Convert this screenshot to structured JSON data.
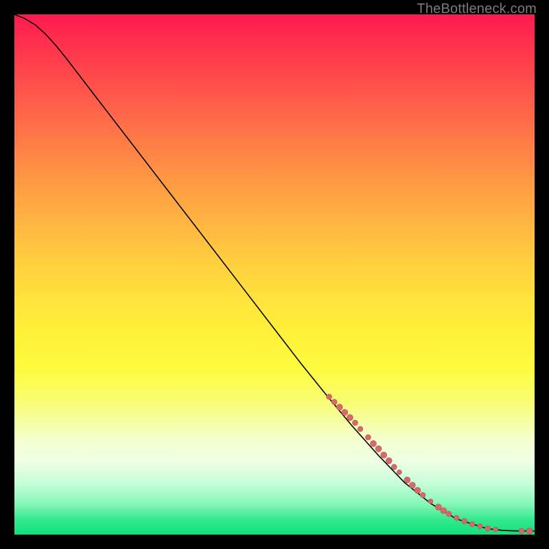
{
  "attribution": "TheBottleneck.com",
  "colors": {
    "line": "#000000",
    "marker_fill": "#d46a6a",
    "marker_stroke": "#b85454",
    "background_black": "#000000"
  },
  "chart_data": {
    "type": "line",
    "title": "",
    "xlabel": "",
    "ylabel": "",
    "xlim": [
      0,
      100
    ],
    "ylim": [
      0,
      100
    ],
    "series": [
      {
        "name": "curve",
        "x": [
          0,
          2,
          4,
          6,
          8,
          10,
          15,
          20,
          25,
          30,
          35,
          40,
          45,
          50,
          55,
          60,
          65,
          70,
          75,
          80,
          85,
          90,
          92,
          94,
          95,
          96,
          97,
          98,
          100
        ],
        "y": [
          100,
          99.2,
          98.0,
          96.2,
          94.0,
          91.5,
          85.0,
          78.5,
          72.0,
          65.5,
          59.0,
          52.5,
          46.0,
          39.5,
          33.0,
          26.8,
          20.8,
          15.2,
          10.0,
          6.0,
          3.0,
          1.4,
          1.0,
          0.8,
          0.75,
          0.72,
          0.7,
          0.7,
          0.7
        ]
      }
    ],
    "markers": {
      "name": "highlighted-points",
      "points": [
        {
          "x": 60.5,
          "y": 26.5,
          "r": 4.0
        },
        {
          "x": 61.5,
          "y": 25.5,
          "r": 4.0
        },
        {
          "x": 62.5,
          "y": 24.5,
          "r": 4.5
        },
        {
          "x": 63.5,
          "y": 23.5,
          "r": 4.5
        },
        {
          "x": 64.5,
          "y": 22.5,
          "r": 4.5
        },
        {
          "x": 65.5,
          "y": 21.5,
          "r": 4.0
        },
        {
          "x": 66.5,
          "y": 20.3,
          "r": 3.8
        },
        {
          "x": 68.0,
          "y": 18.7,
          "r": 4.0
        },
        {
          "x": 69.0,
          "y": 17.5,
          "r": 4.5
        },
        {
          "x": 70.0,
          "y": 16.5,
          "r": 4.5
        },
        {
          "x": 71.0,
          "y": 15.3,
          "r": 4.5
        },
        {
          "x": 72.0,
          "y": 14.2,
          "r": 4.5
        },
        {
          "x": 73.0,
          "y": 13.0,
          "r": 4.0
        },
        {
          "x": 74.0,
          "y": 12.0,
          "r": 3.5
        },
        {
          "x": 75.5,
          "y": 10.5,
          "r": 4.5
        },
        {
          "x": 76.5,
          "y": 9.5,
          "r": 4.5
        },
        {
          "x": 77.5,
          "y": 8.5,
          "r": 4.5
        },
        {
          "x": 78.5,
          "y": 7.6,
          "r": 4.0
        },
        {
          "x": 80.0,
          "y": 6.4,
          "r": 3.5
        },
        {
          "x": 81.5,
          "y": 5.3,
          "r": 4.5
        },
        {
          "x": 82.5,
          "y": 4.6,
          "r": 4.5
        },
        {
          "x": 83.5,
          "y": 4.0,
          "r": 4.0
        },
        {
          "x": 85.0,
          "y": 3.2,
          "r": 3.8
        },
        {
          "x": 86.5,
          "y": 2.6,
          "r": 4.0
        },
        {
          "x": 88.0,
          "y": 2.0,
          "r": 3.8
        },
        {
          "x": 89.5,
          "y": 1.6,
          "r": 3.8
        },
        {
          "x": 91.0,
          "y": 1.2,
          "r": 4.0
        },
        {
          "x": 92.5,
          "y": 1.0,
          "r": 3.5
        },
        {
          "x": 97.5,
          "y": 0.7,
          "r": 4.0
        },
        {
          "x": 99.0,
          "y": 0.7,
          "r": 4.5
        }
      ]
    }
  }
}
